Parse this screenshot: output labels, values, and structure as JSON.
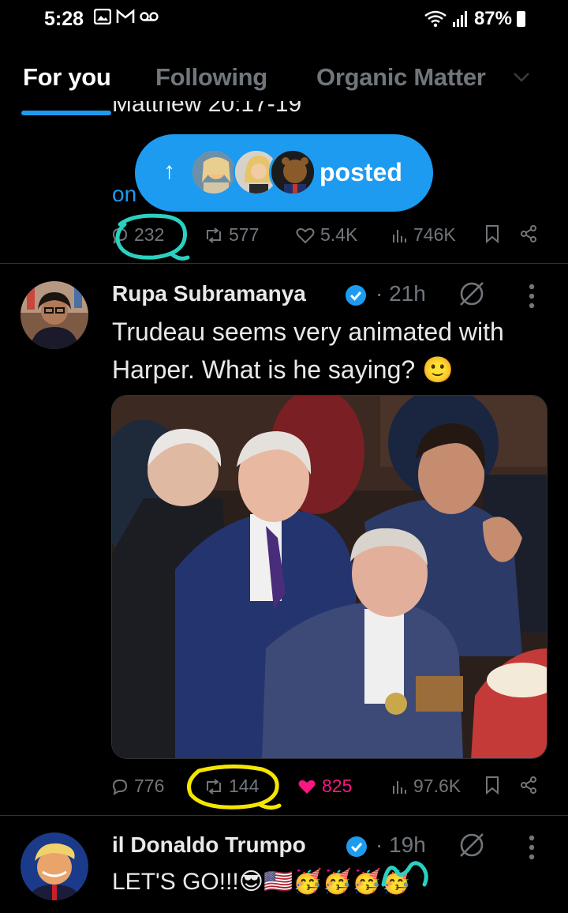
{
  "status_bar": {
    "time": "5:28",
    "battery": "87%"
  },
  "tabs": [
    {
      "label": "For you"
    },
    {
      "label": "Following"
    },
    {
      "label": "Organic Matter"
    }
  ],
  "previous_post": {
    "clipped_text": "Matthew 20:17-19",
    "link_fragment": "on",
    "replies": "232",
    "reposts": "577",
    "likes": "5.4K",
    "views": "746K"
  },
  "posted_pill": {
    "label": "posted"
  },
  "tweets": [
    {
      "author": "Rupa Subramanya",
      "time": "· 21h",
      "text_line1": "Trudeau seems very animated with",
      "text_line2": "Harper. What is he saying? 🙂",
      "replies": "776",
      "reposts": "144",
      "likes": "825",
      "views": "97.6K"
    },
    {
      "author": "il Donaldo Trumpo",
      "time": "· 19h",
      "text": "LET'S GO!!!😎🇺🇸🥳🥳🥳🥳"
    }
  ],
  "colors": {
    "accent": "#1d9bf0",
    "like": "#f91880",
    "muted": "#71767b",
    "annotation_cyan": "#2ad1c0",
    "annotation_yellow": "#f5e600"
  }
}
